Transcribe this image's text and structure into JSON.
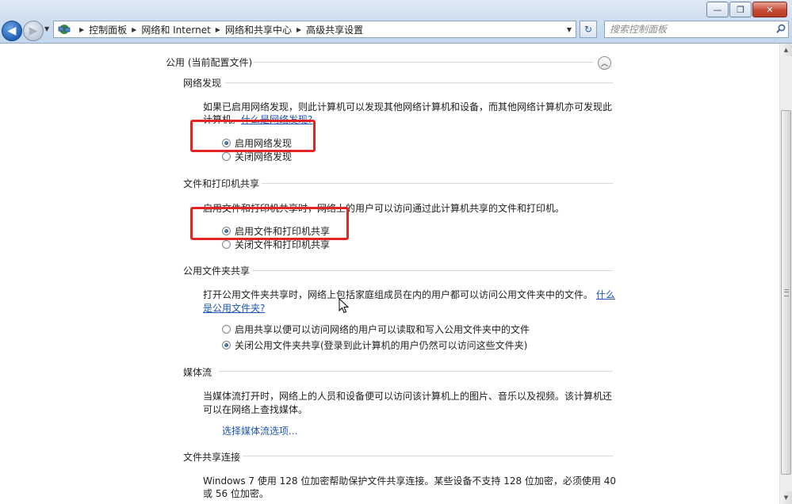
{
  "window": {
    "minimize_glyph": "—",
    "maximize_glyph": "❐",
    "close_glyph": "✕"
  },
  "navigation": {
    "back_glyph": "◀",
    "forward_glyph": "▶",
    "dropdown_glyph": "▼"
  },
  "address_bar": {
    "crumbs": [
      "控制面板",
      "网络和 Internet",
      "网络和共享中心",
      "高级共享设置"
    ],
    "separator_glyph": "▶",
    "dropdown_glyph": "▼",
    "refresh_glyph": "↻"
  },
  "search": {
    "placeholder": "搜索控制面板",
    "icon": "search-icon"
  },
  "profile": {
    "title": "公用 (当前配置文件)",
    "collapse_glyph": "︿"
  },
  "sections": {
    "network_discovery": {
      "title": "网络发现",
      "description_line1": "如果已启用网络发现，则此计算机可以发现其他网络计算机和设备，而其他网络计算机亦可发现此",
      "description_line2": "计算机。",
      "link": "什么是网络发现?",
      "options": [
        {
          "label": "启用网络发现",
          "checked": true
        },
        {
          "label": "关闭网络发现",
          "checked": false
        }
      ]
    },
    "file_printer_sharing": {
      "title": "文件和打印机共享",
      "description": "启用文件和打印机共享时，网络上的用户可以访问通过此计算机共享的文件和打印机。",
      "options": [
        {
          "label": "启用文件和打印机共享",
          "checked": true
        },
        {
          "label": "关闭文件和打印机共享",
          "checked": false
        }
      ]
    },
    "public_folder_sharing": {
      "title": "公用文件夹共享",
      "description_line1": "打开公用文件夹共享时，网络上包括家庭组成员在内的用户都可以访问公用文件夹中的文件。",
      "link_part1": "什么",
      "link_part2": "是公用文件夹?",
      "options": [
        {
          "label": "启用共享以便可以访问网络的用户可以读取和写入公用文件夹中的文件",
          "checked": false
        },
        {
          "label": "关闭公用文件夹共享(登录到此计算机的用户仍然可以访问这些文件夹)",
          "checked": true
        }
      ]
    },
    "media_streaming": {
      "title": "媒体流",
      "description_line1": "当媒体流打开时，网络上的人员和设备便可以访问该计算机上的图片、音乐以及视频。该计算机还",
      "description_line2": "可以在网络上查找媒体。",
      "link": "选择媒体流选项..."
    },
    "file_sharing_connections": {
      "title": "文件共享连接",
      "description_line1": "Windows 7 使用 128 位加密帮助保护文件共享连接。某些设备不支持 128 位加密，必须使用 40",
      "description_line2": "或 56 位加密。"
    }
  },
  "colors": {
    "highlight_box": "#e32424",
    "link": "#1f56b8",
    "chrome_blue": "#cfdff0"
  }
}
